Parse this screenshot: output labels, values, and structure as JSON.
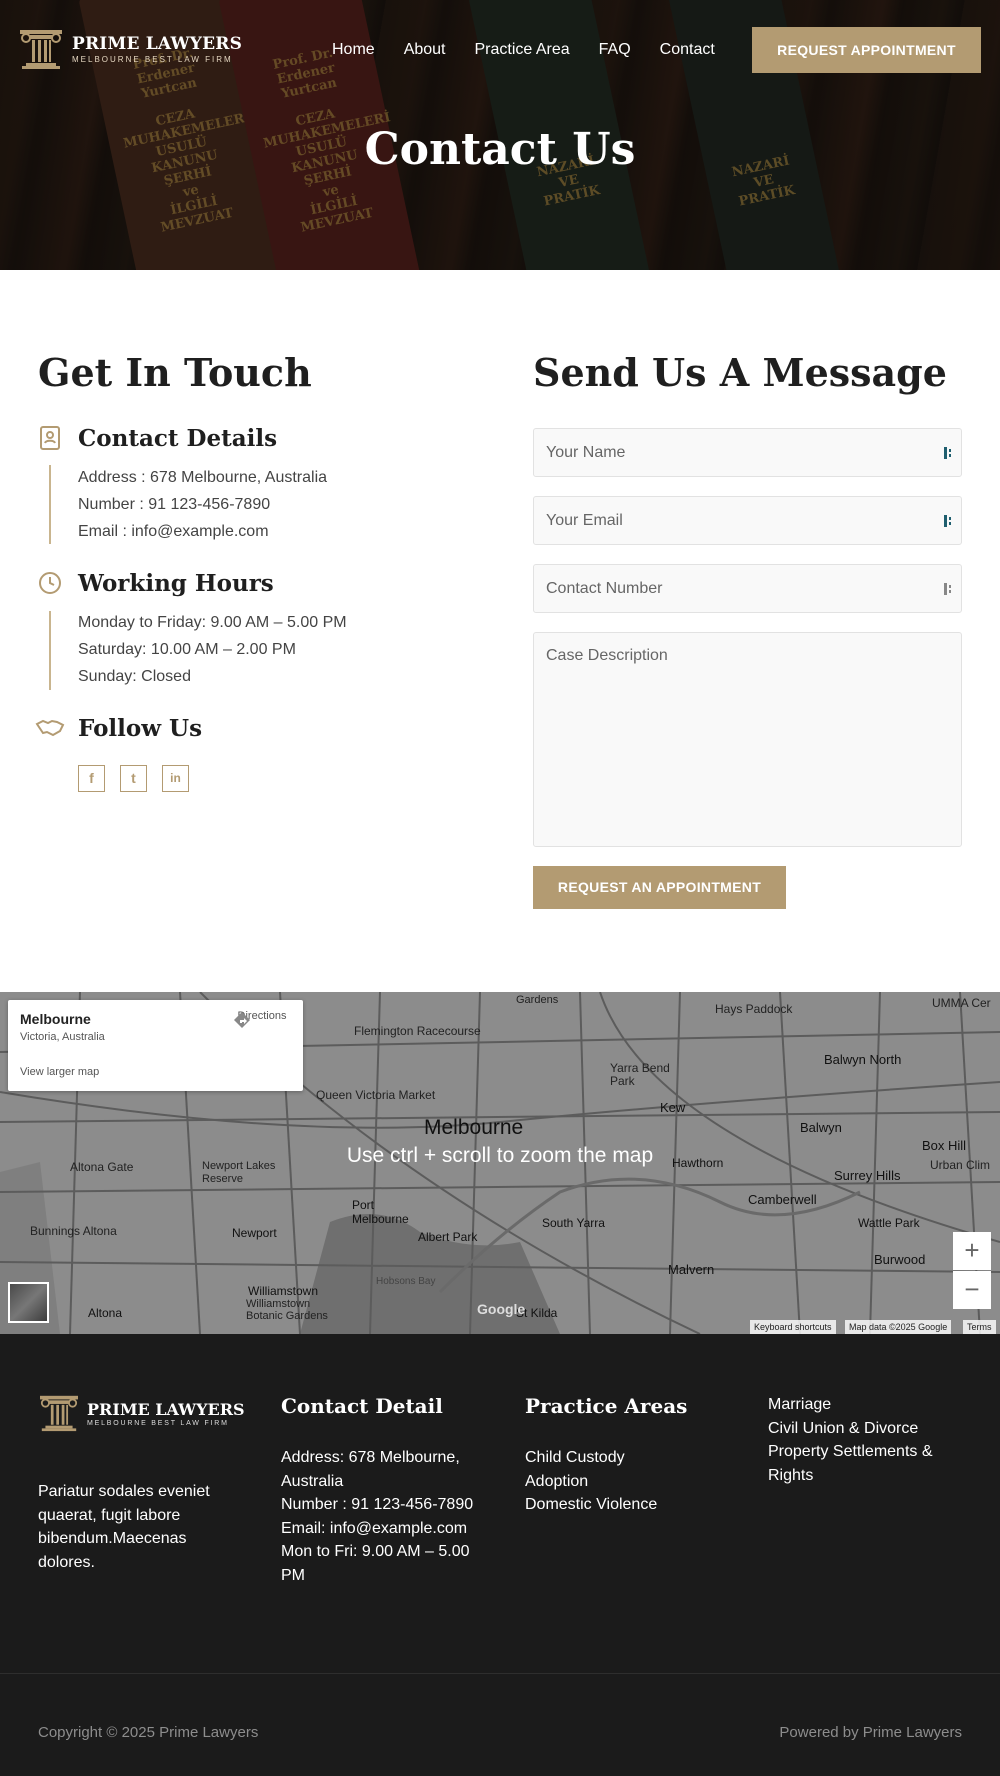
{
  "brand": {
    "name": "PRIME LAWYERS",
    "tagline": "MELBOURNE BEST LAW FIRM"
  },
  "nav": {
    "items": [
      "Home",
      "About",
      "Practice Area",
      "FAQ",
      "Contact"
    ],
    "cta": "REQUEST APPOINTMENT"
  },
  "hero": {
    "title": "Contact Us",
    "book_spines": [
      [
        "Prof. Dr.",
        "Erdener Yurtcan",
        "CEZA",
        "MUHAKEMELERİ",
        "USULÜ KANUNU",
        "ŞERHİ",
        "ve",
        "İLGİLİ MEVZUAT"
      ],
      [
        "NAZARİ",
        "VE",
        "PRATİK"
      ]
    ]
  },
  "contact": {
    "heading": "Get In Touch",
    "details": {
      "title": "Contact Details",
      "lines": [
        "Address : 678 Melbourne, Australia",
        "Number : 91 123-456-7890",
        "Email : info@example.com"
      ]
    },
    "hours": {
      "title": "Working Hours",
      "lines": [
        "Monday to Friday: 9.00 AM – 5.00 PM",
        "Saturday: 10.00 AM – 2.00 PM",
        "Sunday: Closed"
      ]
    },
    "follow": {
      "title": "Follow Us",
      "icons": [
        "facebook-icon",
        "twitter-icon",
        "linkedin-icon"
      ],
      "glyphs": [
        "f",
        "t",
        "in"
      ]
    }
  },
  "form": {
    "heading": "Send Us A Message",
    "name_placeholder": "Your Name",
    "email_placeholder": "Your Email",
    "phone_placeholder": "Contact Number",
    "case_placeholder": "Case Description",
    "submit": "REQUEST AN APPOINTMENT"
  },
  "map": {
    "place": "Melbourne",
    "region": "Victoria, Australia",
    "directions": "Directions",
    "larger_map": "View larger map",
    "hint": "Use ctrl + scroll to zoom the map",
    "city_label": "Melbourne",
    "labels": [
      "Flemington Racecourse",
      "Queen Victoria Market",
      "Yarra Bend Park",
      "Hays Paddock",
      "Balwyn North",
      "Kew",
      "Balwyn",
      "Box Hill",
      "Hawthorn",
      "Surrey Hills",
      "Camberwell",
      "Wattle Park",
      "Burwood",
      "Malvern",
      "South Yarra",
      "Albert Park",
      "Port Melbourne",
      "Newport",
      "Newport Lakes Reserve",
      "Altona Gate",
      "Bunnings Altona",
      "Williamstown",
      "Williamstown Botanic Gardens",
      "Altona",
      "St Kilda",
      "Hobsons Bay",
      "Gardens",
      "UMMA Cer",
      "Urban Clim"
    ],
    "zoom_in": "+",
    "zoom_out": "−",
    "google": "Google",
    "attribution": [
      "Keyboard shortcuts",
      "Map data ©2025 Google",
      "Terms"
    ]
  },
  "footer": {
    "about": "Pariatur sodales eveniet quaerat, fugit labore bibendum.Maecenas dolores.",
    "contact_title": "Contact Detail",
    "contact_lines": [
      "Address: 678 Melbourne, Australia",
      "Number : 91 123-456-7890",
      "Email: info@example.com",
      "Mon to Fri: 9.00 AM – 5.00 PM"
    ],
    "practice_title": "Practice Areas",
    "practice_col1": [
      "Child Custody",
      "Adoption",
      "Domestic Violence"
    ],
    "practice_col2": [
      "Marriage",
      "Civil Union & Divorce",
      "Property Settlements & Rights"
    ],
    "copyright": "Copyright © 2025 Prime Lawyers",
    "powered": "Powered by Prime Lawyers"
  },
  "colors": {
    "accent": "#b39b72",
    "footer_bg": "#1b1b1b",
    "heading": "#1f1f1f"
  }
}
